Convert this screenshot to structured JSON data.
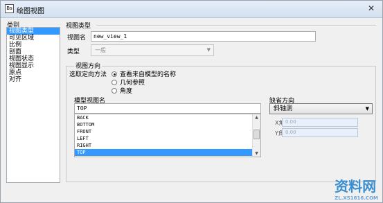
{
  "window": {
    "title": "绘图视图",
    "app_icon": "Bs",
    "close_glyph": "✕"
  },
  "sidebar": {
    "header": "类别",
    "items": [
      {
        "label": "视图类型",
        "selected": true
      },
      {
        "label": "可见区域",
        "selected": false
      },
      {
        "label": "比例",
        "selected": false
      },
      {
        "label": "剖面",
        "selected": false
      },
      {
        "label": "视图状态",
        "selected": false
      },
      {
        "label": "视图显示",
        "selected": false
      },
      {
        "label": "原点",
        "selected": false
      },
      {
        "label": "对齐",
        "selected": false
      }
    ]
  },
  "view_type": {
    "section_title": "视图类型",
    "name_label": "视图名",
    "name_value": "new_view_1",
    "type_label": "类型",
    "type_value": "一般"
  },
  "orientation": {
    "section_title": "视图方向",
    "method_label": "选取定向方法",
    "options": [
      {
        "label": "查看来自模型的名称",
        "checked": true
      },
      {
        "label": "几何参照",
        "checked": false
      },
      {
        "label": "角度",
        "checked": false
      }
    ],
    "model_view_label": "模型视图名",
    "model_view_value": "TOP",
    "views": [
      {
        "label": "BACK",
        "selected": false
      },
      {
        "label": "BOTTOM",
        "selected": false
      },
      {
        "label": "FRONT",
        "selected": false
      },
      {
        "label": "LEFT",
        "selected": false
      },
      {
        "label": "RIGHT",
        "selected": false
      },
      {
        "label": "TOP",
        "selected": true
      }
    ],
    "default_dir_label": "缺省方向",
    "default_dir_value": "斜轴测",
    "x_angle_label": "X角度",
    "x_angle_value": "0.00",
    "y_angle_label": "Y角度",
    "y_angle_value": "0.00"
  },
  "watermark": {
    "text": "资料网",
    "url": "ZL.XS1616.COM"
  },
  "colors": {
    "selection": "#3399ff",
    "title_bar": "#dbe6f3"
  }
}
